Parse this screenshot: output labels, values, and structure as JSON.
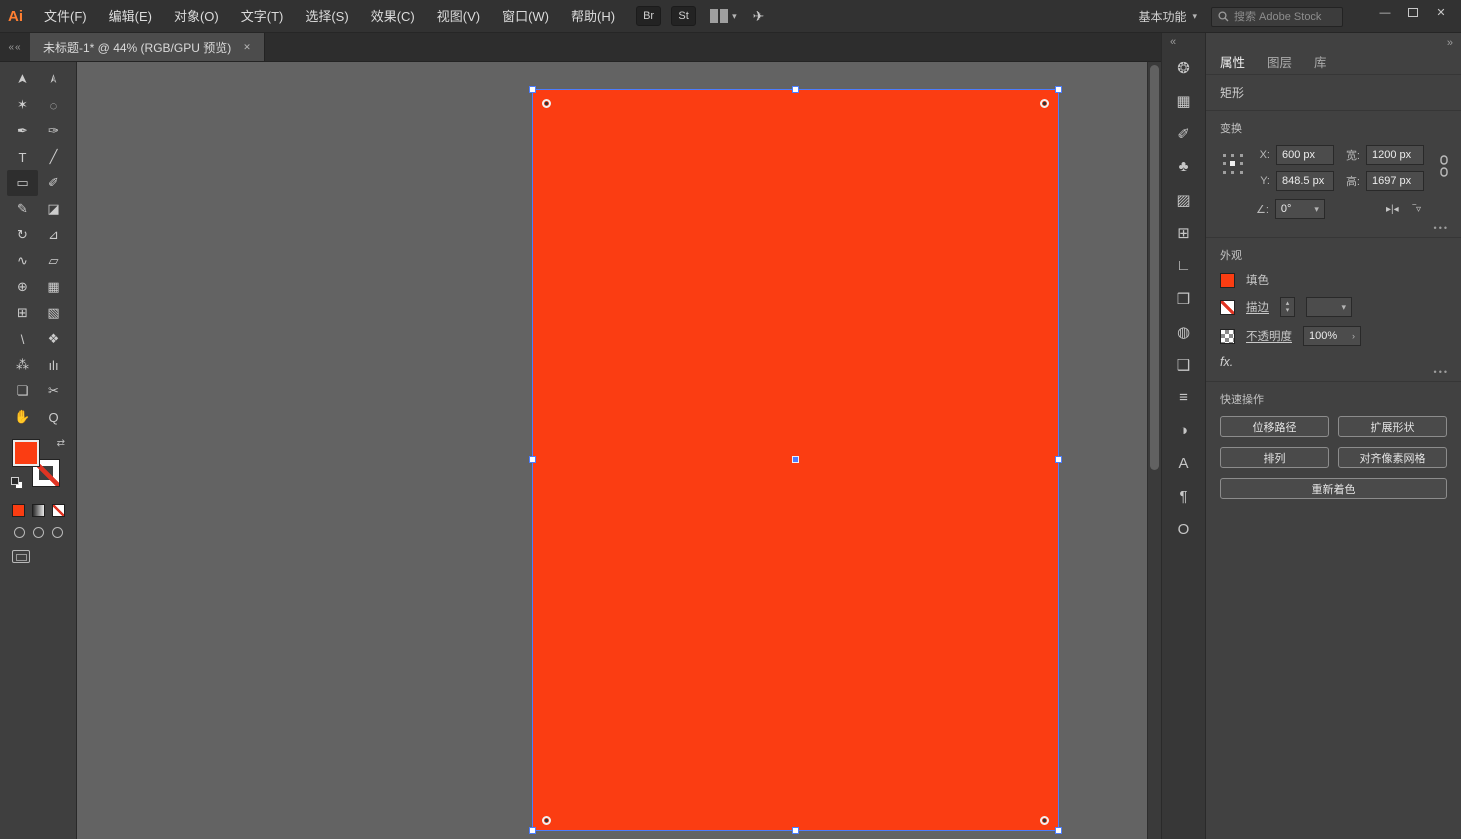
{
  "glyphs": {
    "caret": "▾",
    "chevron": "›",
    "swap": "⇄",
    "collapse_left": "««",
    "collapse": "«",
    "expand": "»",
    "close": "✕",
    "minimize": "—",
    "more": "•••",
    "spin_up": "▴",
    "spin_down": "▾",
    "flip_h": "▸|◂",
    "flip_v": "‾▿"
  },
  "colors": {
    "artboard_fill": "#FB3D12",
    "selection_blue": "#4B7DFF",
    "logo_orange": "#FF7F32"
  },
  "menubar": {
    "logo": "Ai",
    "menus": [
      "文件(F)",
      "编辑(E)",
      "对象(O)",
      "文字(T)",
      "选择(S)",
      "效果(C)",
      "视图(V)",
      "窗口(W)",
      "帮助(H)"
    ],
    "bridge": "Br",
    "stock": "St",
    "workspace": "基本功能",
    "search_placeholder": "搜索 Adobe Stock"
  },
  "tabbar": {
    "document_tab": "未标题-1* @ 44% (RGB/GPU 预览)"
  },
  "tools": [
    {
      "n": "selection-tool",
      "g": "➤"
    },
    {
      "n": "direct-selection-tool",
      "g": "➣"
    },
    {
      "n": "magic-wand-tool",
      "g": "✶"
    },
    {
      "n": "lasso-tool",
      "g": "◌"
    },
    {
      "n": "pen-tool",
      "g": "✒"
    },
    {
      "n": "curvature-tool",
      "g": "✑"
    },
    {
      "n": "type-tool",
      "g": "T"
    },
    {
      "n": "line-segment-tool",
      "g": "╱"
    },
    {
      "n": "rectangle-tool",
      "g": "▭"
    },
    {
      "n": "paintbrush-tool",
      "g": "✐"
    },
    {
      "n": "shaper-tool",
      "g": "✎"
    },
    {
      "n": "eraser-tool",
      "g": "◪"
    },
    {
      "n": "rotate-tool",
      "g": "↻"
    },
    {
      "n": "scale-tool",
      "g": "⊿"
    },
    {
      "n": "width-tool",
      "g": "∿"
    },
    {
      "n": "free-transform-tool",
      "g": "▱"
    },
    {
      "n": "shape-builder-tool",
      "g": "⊕"
    },
    {
      "n": "perspective-grid-tool",
      "g": "▦"
    },
    {
      "n": "mesh-tool",
      "g": "⊞"
    },
    {
      "n": "gradient-tool",
      "g": "▧"
    },
    {
      "n": "eyedropper-tool",
      "g": "\\"
    },
    {
      "n": "blend-tool",
      "g": "❖"
    },
    {
      "n": "symbol-sprayer-tool",
      "g": "⁂"
    },
    {
      "n": "column-graph-tool",
      "g": "ılı"
    },
    {
      "n": "artboard-tool",
      "g": "❏"
    },
    {
      "n": "slice-tool",
      "g": "✂"
    },
    {
      "n": "hand-tool",
      "g": "✋"
    },
    {
      "n": "zoom-tool",
      "g": "Q"
    }
  ],
  "dock_icons": [
    {
      "n": "color-panel-icon",
      "g": "❂"
    },
    {
      "n": "swatches-panel-icon",
      "g": "▦"
    },
    {
      "n": "brushes-panel-icon",
      "g": "✐"
    },
    {
      "n": "symbols-panel-icon",
      "g": "♣"
    },
    {
      "n": "gradient-panel-icon",
      "g": "▨"
    },
    {
      "n": "transform-panel-icon",
      "g": "⊞"
    },
    {
      "n": "align-panel-icon",
      "g": "∟"
    },
    {
      "n": "pathfinder-panel-icon",
      "g": "❒"
    },
    {
      "n": "appearance-panel-icon",
      "g": "◍"
    },
    {
      "n": "graphic-styles-panel-icon",
      "g": "❑"
    },
    {
      "n": "stroke-panel-icon",
      "g": "≡"
    },
    {
      "n": "transparency-panel-icon",
      "g": "◑"
    },
    {
      "n": "character-styles-panel-icon",
      "g": "A"
    },
    {
      "n": "paragraph-panel-icon",
      "g": "¶"
    },
    {
      "n": "opentype-panel-icon",
      "g": "O"
    }
  ],
  "properties": {
    "tabs": [
      "属性",
      "图层",
      "库"
    ],
    "object_type": "矩形",
    "transform": {
      "title": "变换",
      "x_label": "X:",
      "x_value": "600 px",
      "y_label": "Y:",
      "y_value": "848.5 px",
      "w_label": "宽:",
      "w_value": "1200 px",
      "h_label": "高:",
      "h_value": "1697 px",
      "angle_label": "∠:",
      "angle_value": "0°"
    },
    "appearance": {
      "title": "外观",
      "fill_label": "填色",
      "stroke_label": "描边",
      "opacity_label": "不透明度",
      "opacity_value": "100%",
      "fx": "fx."
    },
    "quick_actions": {
      "title": "快速操作",
      "offset_path": "位移路径",
      "expand_shape": "扩展形状",
      "arrange": "排列",
      "align_pixel_grid": "对齐像素网格",
      "recolor": "重新着色"
    }
  }
}
